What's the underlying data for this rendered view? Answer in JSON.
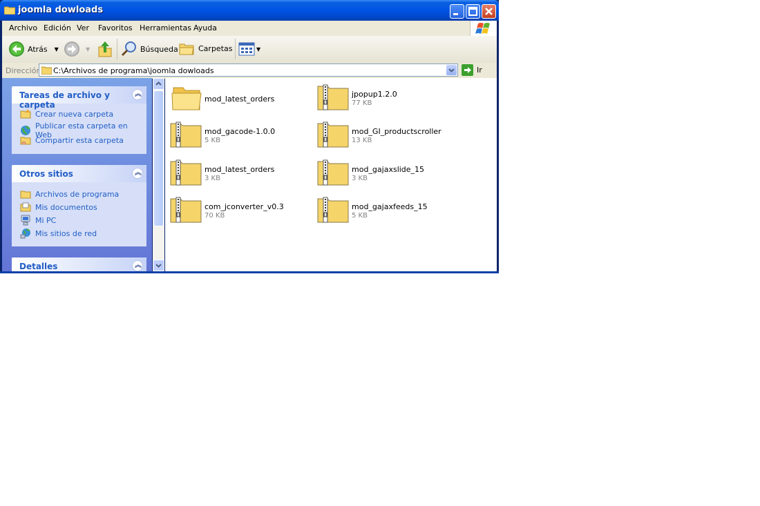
{
  "window": {
    "title": "joomla dowloads",
    "title_color": "#0054e3"
  },
  "menubar": {
    "items": [
      "Archivo",
      "Edición",
      "Ver",
      "Favoritos",
      "Herramientas",
      "Ayuda"
    ]
  },
  "toolbar": {
    "back_label": "Atrás",
    "search_label": "Búsqueda",
    "folders_label": "Carpetas"
  },
  "address": {
    "label": "Dirección",
    "value": "C:\\Archivos de programa\\joomla dowloads",
    "go_label": "Ir"
  },
  "tasks": {
    "title": "Tareas de archivo y carpeta",
    "items": [
      "Crear nueva carpeta",
      "Publicar esta carpeta en Web",
      "Compartir esta carpeta"
    ]
  },
  "places": {
    "title": "Otros sitios",
    "items": [
      "Archivos de programa",
      "Mis documentos",
      "Mi PC",
      "Mis sitios de red"
    ]
  },
  "details": {
    "title": "Detalles"
  },
  "files": [
    {
      "name": "mod_latest_orders",
      "size": "",
      "type": "folder"
    },
    {
      "name": "jpopup1.2.0",
      "size": "77 KB",
      "type": "zip"
    },
    {
      "name": "mod_gacode-1.0.0",
      "size": "5 KB",
      "type": "zip"
    },
    {
      "name": "mod_GI_productscroller",
      "size": "13 KB",
      "type": "zip"
    },
    {
      "name": "mod_latest_orders",
      "size": "3 KB",
      "type": "zip"
    },
    {
      "name": "mod_gajaxslide_15",
      "size": "3 KB",
      "type": "zip"
    },
    {
      "name": "com_jconverter_v0.3",
      "size": "70 KB",
      "type": "zip"
    },
    {
      "name": "mod_gajaxfeeds_15",
      "size": "5 KB",
      "type": "zip"
    }
  ]
}
